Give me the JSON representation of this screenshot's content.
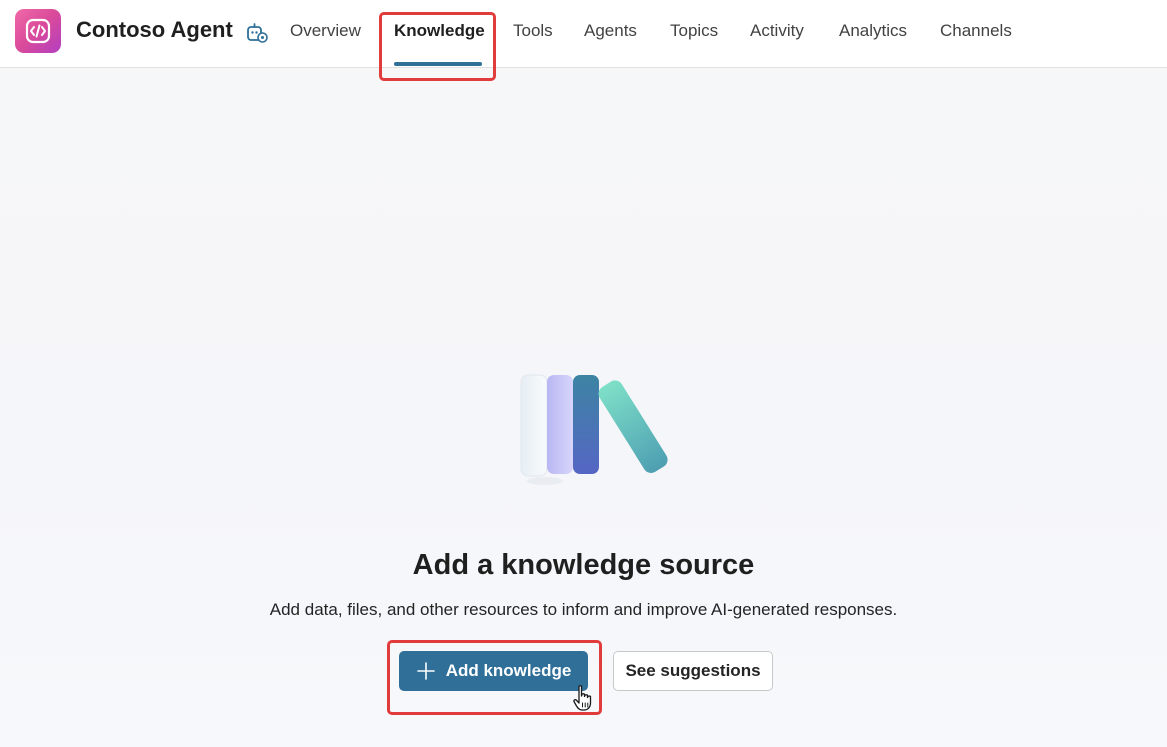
{
  "app": {
    "title": "Contoso Agent"
  },
  "nav": {
    "tabs": [
      {
        "label": "Overview",
        "active": false
      },
      {
        "label": "Knowledge",
        "active": true
      },
      {
        "label": "Tools",
        "active": false
      },
      {
        "label": "Agents",
        "active": false
      },
      {
        "label": "Topics",
        "active": false
      },
      {
        "label": "Activity",
        "active": false
      },
      {
        "label": "Analytics",
        "active": false
      },
      {
        "label": "Channels",
        "active": false
      }
    ]
  },
  "empty_state": {
    "title": "Add a knowledge source",
    "subtitle": "Add data, files, and other resources to inform and improve AI-generated responses.",
    "primary_button": "Add knowledge",
    "secondary_button": "See suggestions"
  },
  "icons": {
    "logo": "code-logo-icon",
    "agent_settings": "agent-settings-icon",
    "add": "plus-icon",
    "pointer": "hand-pointer-icon"
  },
  "colors": {
    "accent": "#2f6f98",
    "highlight": "#e03c3c",
    "logo_start": "#f06aa8",
    "logo_end": "#b23fc1"
  }
}
